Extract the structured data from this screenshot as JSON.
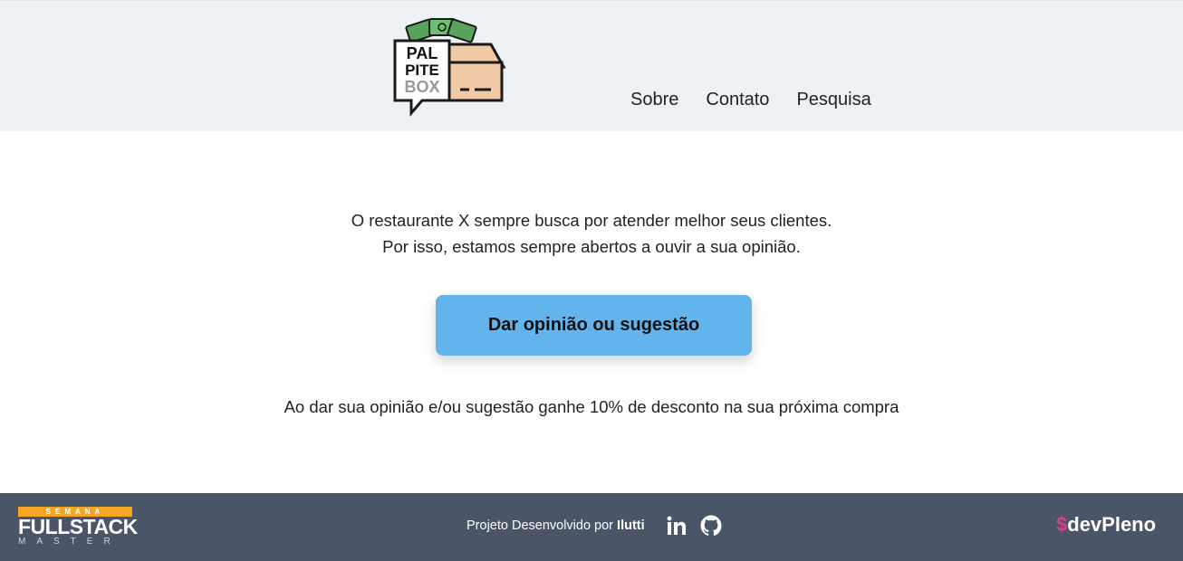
{
  "header": {
    "logo": {
      "lines": [
        "PAL",
        "PITE",
        "BOX"
      ],
      "icon": "palpitebox-logo-icon"
    },
    "nav": [
      {
        "label": "Sobre"
      },
      {
        "label": "Contato"
      },
      {
        "label": "Pesquisa"
      }
    ]
  },
  "main": {
    "intro_line1": "O restaurante X sempre busca por atender melhor seus clientes.",
    "intro_line2": "Por isso, estamos sempre abertos a ouvir a sua opinião.",
    "cta_label": "Dar opinião ou sugestão",
    "note": "Ao dar sua opinião e/ou sugestão ganhe 10% de desconto na sua próxima compra"
  },
  "footer": {
    "fsm_logo": {
      "top": "SEMANA",
      "middle": "FULLSTACK",
      "bottom": "MASTER"
    },
    "credit_prefix": "Projeto Desenvolvido por ",
    "credit_name": "Ilutti",
    "social_icons": [
      "linkedin-icon",
      "github-icon"
    ],
    "devpleno_logo": {
      "symbol": "$",
      "text": "devPleno"
    }
  },
  "colors": {
    "header_bg": "#edf2f7",
    "cta_bg": "#63b3ed",
    "footer_bg": "#4a5568",
    "fsm_orange": "#f6a623",
    "devpleno_pink": "#d53f8c"
  }
}
